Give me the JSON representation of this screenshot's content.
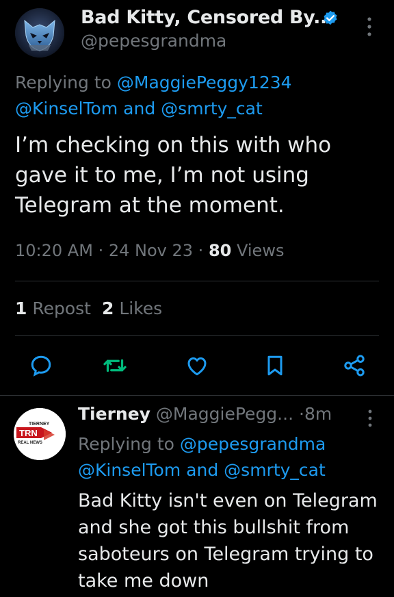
{
  "main_tweet": {
    "author_name": "Bad Kitty, Censored By...",
    "author_handle": "@pepesgrandma",
    "replying_prefix": "Replying to",
    "replying_mention_1": "@MaggiePeggy1234",
    "replying_mention_2": "@KinselTom",
    "replying_and": "and",
    "replying_mention_3": "@smrty_cat",
    "text": "I’m checking on this with who gave it to me, I’m not using Telegram at the moment.",
    "time": "10:20 AM",
    "date": "24 Nov 23",
    "meta_separator": "·",
    "views_count": "80",
    "views_label": "Views",
    "repost_count": "1",
    "repost_label": "Repost",
    "likes_count": "2",
    "likes_label": "Likes"
  },
  "actions": {
    "icons": [
      "reply-icon",
      "repost-icon",
      "like-icon",
      "bookmark-icon",
      "share-icon"
    ],
    "repost_color": "#00ba7c",
    "icon_color": "#1d9bf0"
  },
  "reply_tweet": {
    "author_name": "Tierney",
    "author_handle": "@MaggiePegg...",
    "time_sep": "·",
    "time": "8m",
    "avatar_text_top": "TIERNEY",
    "avatar_text_mid": "TRN",
    "avatar_text_bot": "REAL NEWS",
    "replying_prefix": "Replying to",
    "replying_mention_1": "@pepesgrandma",
    "replying_mention_2": "@KinselTom",
    "replying_and": "and",
    "replying_mention_3": "@smrty_cat",
    "text": "Bad Kitty isn't even on Telegram and she got this bullshit from saboteurs on Telegram trying to take me down"
  },
  "colors": {
    "background": "#000000",
    "text_primary": "#e7e9ea",
    "text_secondary": "#71767b",
    "link": "#1d9bf0",
    "divider": "#2f3336"
  }
}
